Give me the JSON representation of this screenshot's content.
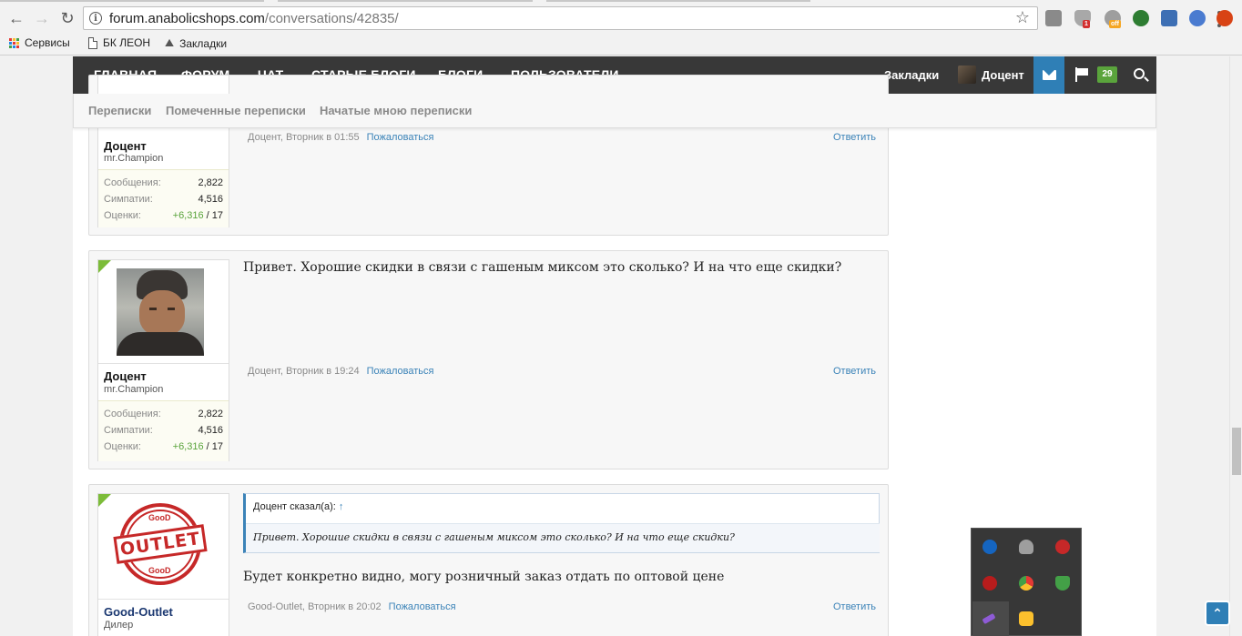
{
  "browser": {
    "url_host": "forum.anabolicshops.com",
    "url_path": "/conversations/42835/",
    "extension_badges": {
      "ublock": "1",
      "off": "off"
    },
    "bookmarks": [
      {
        "label": "Сервисы",
        "icon": "apps-grid-icon"
      },
      {
        "label": "БК ЛЕОН",
        "icon": "page-icon"
      },
      {
        "label": "Закладки",
        "icon": "bookmarks-folder-icon"
      }
    ]
  },
  "main_nav": {
    "items": [
      "ГЛАВНАЯ",
      "ФОРУМ",
      "ЧАТ",
      "СТАРЫЕ БЛОГИ",
      "БЛОГИ",
      "ПОЛЬЗОВАТЕЛИ"
    ],
    "bookmarks_label": "Закладки",
    "user_name": "Доцент",
    "alerts_count": "29"
  },
  "sub_nav": {
    "items": [
      "Переписки",
      "Помеченные переписки",
      "Начатые мною переписки"
    ]
  },
  "messages": [
    {
      "user": {
        "name": "Доцент",
        "title": "mr.Champion",
        "stats": [
          {
            "label": "Сообщения:",
            "value": "2,822"
          },
          {
            "label": "Симпатии:",
            "value": "4,516"
          },
          {
            "label": "Оценки:",
            "value_pos": "+6,316",
            "value_rest": " / 17"
          }
        ]
      },
      "text": "",
      "meta": "Доцент, Вторник в 01:55",
      "report_label": "Пожаловаться",
      "reply_label": "Ответить"
    },
    {
      "user": {
        "name": "Доцент",
        "title": "mr.Champion",
        "stats": [
          {
            "label": "Сообщения:",
            "value": "2,822"
          },
          {
            "label": "Симпатии:",
            "value": "4,516"
          },
          {
            "label": "Оценки:",
            "value_pos": "+6,316",
            "value_rest": " / 17"
          }
        ]
      },
      "text": "Привет. Хорошие скидки в связи с гашеным миксом это сколько? И на что еще скидки?",
      "meta": "Доцент, Вторник в 19:24",
      "report_label": "Пожаловаться",
      "reply_label": "Ответить"
    },
    {
      "user": {
        "name": "Good-Outlet",
        "title": "Дилер",
        "stamp_text": "OUTLET",
        "stamp_small": "GooD"
      },
      "quote": {
        "head": "Доцент сказал(а):",
        "arrow": "↑",
        "body": "Привет. Хорошие скидки в связи с гашеным миксом это сколько? И на что еще скидки?"
      },
      "text": "Будет конкретно видно, могу розничный заказ отдать по оптовой цене",
      "meta": "Good-Outlet, Вторник в 20:02",
      "report_label": "Пожаловаться",
      "reply_label": "Ответить"
    }
  ],
  "tray": {
    "icons": [
      "bluetooth-icon",
      "onedrive-icon",
      "network-monitor-icon",
      "speedometer-icon",
      "chrome-icon",
      "security-shield-icon",
      "feather-icon",
      "puzzle-icon"
    ]
  },
  "colors": {
    "nav_bg": "#383838",
    "accent": "#2f7fb6",
    "link": "#3b83b8",
    "online": "#7cbc39",
    "count_badge": "#5aa43c"
  }
}
